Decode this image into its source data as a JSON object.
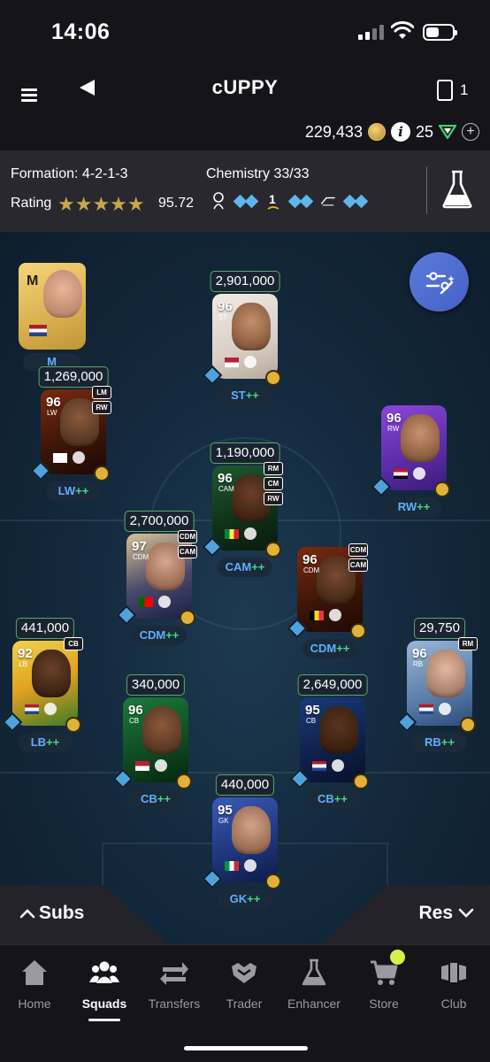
{
  "status": {
    "time": "14:06"
  },
  "header": {
    "squad_name": "cUPPY",
    "pack_count": "1",
    "coins": "229,433",
    "points": "25"
  },
  "panel": {
    "formation": "Formation: 4-2-1-3",
    "chemistry": "Chemistry 33/33",
    "rating_label": "Rating",
    "rating_value": "95.72",
    "stars": "★★★★★"
  },
  "manager": {
    "initial": "M",
    "label": "M"
  },
  "players": [
    {
      "price": "2,901,000",
      "ovr": "96",
      "pos": "ST",
      "chem_label": "ST",
      "alts": []
    },
    {
      "price": "1,269,000",
      "ovr": "96",
      "pos": "LW",
      "chem_label": "LW",
      "alts": [
        "LM",
        "RW"
      ]
    },
    {
      "price": "",
      "ovr": "96",
      "pos": "RW",
      "chem_label": "RW",
      "alts": []
    },
    {
      "price": "1,190,000",
      "ovr": "96",
      "pos": "CAM",
      "chem_label": "CAM",
      "alts": [
        "RM",
        "CM",
        "RW"
      ]
    },
    {
      "price": "2,700,000",
      "ovr": "97",
      "pos": "CDM",
      "chem_label": "CDM",
      "alts": [
        "CDM",
        "CAM"
      ]
    },
    {
      "price": "",
      "ovr": "96",
      "pos": "CDM",
      "chem_label": "CDM",
      "alts": [
        "CDM",
        "CAM"
      ]
    },
    {
      "price": "441,000",
      "ovr": "92",
      "pos": "LB",
      "chem_label": "LB",
      "alts": [
        "CB"
      ]
    },
    {
      "price": "29,750",
      "ovr": "96",
      "pos": "RB",
      "chem_label": "RB",
      "alts": [
        "RM"
      ]
    },
    {
      "price": "340,000",
      "ovr": "96",
      "pos": "CB",
      "chem_label": "CB",
      "alts": []
    },
    {
      "price": "2,649,000",
      "ovr": "95",
      "pos": "CB",
      "chem_label": "CB",
      "alts": []
    },
    {
      "price": "440,000",
      "ovr": "95",
      "pos": "GK",
      "chem_label": "GK",
      "alts": []
    }
  ],
  "plus_suffix": "++",
  "tabs": {
    "subs": "Subs",
    "res": "Res"
  },
  "nav": [
    {
      "label": "Home",
      "icon": "home-icon"
    },
    {
      "label": "Squads",
      "icon": "squads-icon"
    },
    {
      "label": "Transfers",
      "icon": "transfers-icon"
    },
    {
      "label": "Trader",
      "icon": "trader-icon"
    },
    {
      "label": "Enhancer",
      "icon": "enhancer-icon"
    },
    {
      "label": "Store",
      "icon": "store-icon"
    },
    {
      "label": "Club",
      "icon": "club-icon"
    }
  ],
  "colors": {
    "accent_blue": "#5fb0ff",
    "accent_green": "#43d88a",
    "price_border": "#5aa86c",
    "fab": "#4f6bd0",
    "gold": "#c8a64a"
  }
}
